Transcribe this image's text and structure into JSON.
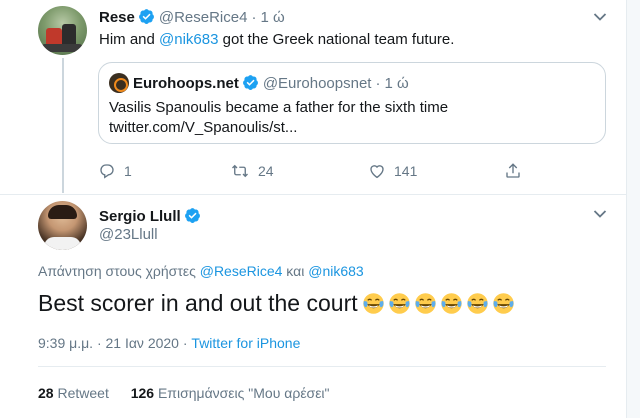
{
  "reply_parent": {
    "name": "Rese",
    "handle": "@ReseRice4",
    "time": "1 ώ",
    "text_before": "Him and ",
    "mention": "@nik683",
    "text_after": " got the Greek national team future.",
    "quoted": {
      "name": "Eurohoops.net",
      "handle": "@Eurohoopsnet",
      "time": "1 ώ",
      "line1": "Vasilis Spanoulis became a father for the sixth time",
      "line2": "twitter.com/V_Spanoulis/st..."
    },
    "actions": {
      "replies": "1",
      "retweets": "24",
      "likes": "141"
    }
  },
  "main_tweet": {
    "name": "Sergio Llull",
    "handle": "@23Llull",
    "replying_prefix": "Απάντηση στους χρήστες ",
    "replying_user1": "@ReseRice4",
    "replying_and": " και ",
    "replying_user2": "@nik683",
    "text": "Best scorer in and out the court",
    "emoji_count": 6,
    "timestamp": "9:39 μ.μ. · 21 Ιαν 2020 · ",
    "source": "Twitter for iPhone",
    "retweet_count": "28",
    "retweet_label": "Retweet",
    "like_count": "126",
    "like_label": "Επισημάνσεις \"Μου αρέσει\""
  },
  "colors": {
    "link": "#1b95e0",
    "verified": "#1da1f2",
    "secondary_text": "#657786"
  },
  "icons": [
    "verified-badge-icon",
    "chevron-down-icon",
    "reply-icon",
    "retweet-icon",
    "like-icon",
    "share-icon",
    "crying-laughing-emoji"
  ]
}
